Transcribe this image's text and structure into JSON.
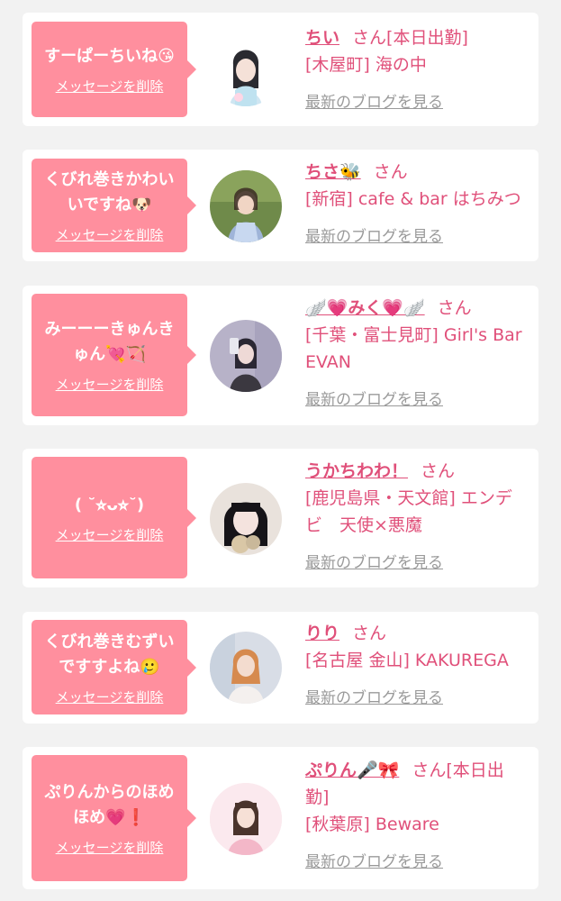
{
  "items": [
    {
      "message": "すーぱーちいね😘",
      "delete_label": "メッセージを削除",
      "cast_name": "ちい",
      "honorific": "さん",
      "status": "[本日出勤]",
      "shop": "[木屋町] 海の中",
      "blog_label": "最新のブログを見る"
    },
    {
      "message": "くびれ巻きかわいいですね🐶",
      "delete_label": "メッセージを削除",
      "cast_name": "ちさ🐝",
      "honorific": "さん",
      "status": "",
      "shop": "[新宿] cafe & bar はちみつ",
      "blog_label": "最新のブログを見る"
    },
    {
      "message": "みーーーきゅんきゅん💘🏹",
      "delete_label": "メッセージを削除",
      "cast_name": "🪽💗みく💗🪽",
      "honorific": "さん",
      "status": "",
      "shop": "[千葉・富士見町] Girl's Bar EVAN",
      "blog_label": "最新のブログを見る"
    },
    {
      "message": "( ˘⭐︎ᴗ⭐︎˘)",
      "delete_label": "メッセージを削除",
      "cast_name": "うかちわわ！",
      "honorific": "さん",
      "status": "",
      "shop": "[鹿児島県・天文館] エンデビ　天使×悪魔",
      "blog_label": "最新のブログを見る"
    },
    {
      "message": "くびれ巻きむずいですすよね🥲",
      "delete_label": "メッセージを削除",
      "cast_name": "りり",
      "honorific": "さん",
      "status": "",
      "shop": "[名古屋 金山] KAKUREGA",
      "blog_label": "最新のブログを見る"
    },
    {
      "message": "ぷりんからのほめほめ💗❗️",
      "delete_label": "メッセージを削除",
      "cast_name": "ぷりん🎤🎀",
      "honorific": "さん",
      "status": "[本日出勤]",
      "shop": "[秋葉原] Beware",
      "blog_label": "最新のブログを見る"
    }
  ]
}
